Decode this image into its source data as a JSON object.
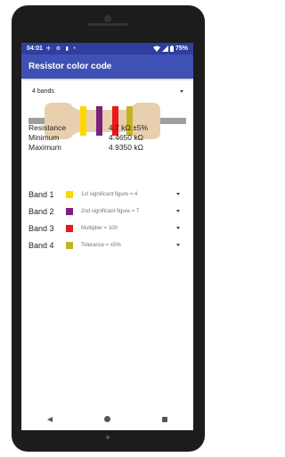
{
  "status": {
    "time": "04:01",
    "icons": "✣ ⚙ ▮ •",
    "battery": "75%"
  },
  "app": {
    "title": "Resistor color code"
  },
  "band_count": {
    "selected": "4 bands"
  },
  "resistor": {
    "lead_color": "#9e9e9e",
    "body_color": "#e8cfae",
    "band_colors": [
      "#ffd700",
      "#7b1f7e",
      "#e8181b",
      "#c4b224"
    ]
  },
  "values": [
    {
      "label": "Resistance",
      "value": "4.7 kΩ ±5%"
    },
    {
      "label": "Minimum",
      "value": "4.4650 kΩ"
    },
    {
      "label": "Maximum",
      "value": "4.9350 kΩ"
    }
  ],
  "bands": [
    {
      "label": "Band 1",
      "color": "#ffd700",
      "text": "1st significant figure = 4"
    },
    {
      "label": "Band 2",
      "color": "#7b1f7e",
      "text": "2nd significant figure = 7"
    },
    {
      "label": "Band 3",
      "color": "#e8181b",
      "text": "Multiplier = 100"
    },
    {
      "label": "Band 4",
      "color": "#c4b224",
      "text": "Tolerance = ±5%"
    }
  ]
}
